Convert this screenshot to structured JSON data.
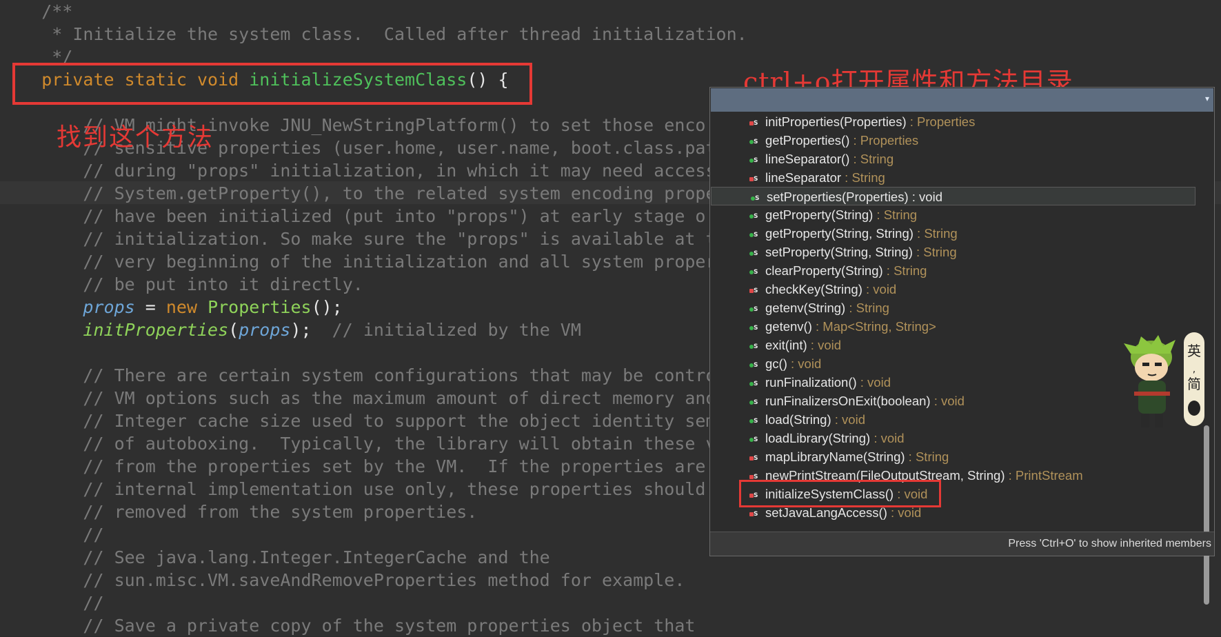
{
  "code": {
    "line1": "    /**",
    "line2": "     * Initialize the system class.  Called after thread initialization.",
    "line3": "     */",
    "decl_kw": "private static void ",
    "decl_fn": "initializeSystemClass",
    "decl_end": "() {",
    "c1": "        // VM might invoke JNU_NewStringPlatform() to set those enco",
    "c2": "        // sensitive properties (user.home, user.name, boot.class.pat",
    "c3": "        // during \"props\" initialization, in which it may need access",
    "c4": "        // System.getProperty(), to the related system encoding prope",
    "c5": "        // have been initialized (put into \"props\") at early stage o",
    "c6": "        // initialization. So make sure the \"props\" is available at t",
    "c7": "        // very beginning of the initialization and all system proper",
    "c8": "        // be put into it directly.",
    "s1_var": "props",
    "s1_eq": " = ",
    "s1_new": "new ",
    "s1_cls": "Properties",
    "s1_end": "();",
    "s2_fn": "initProperties",
    "s2_open": "(",
    "s2_arg": "props",
    "s2_close": ");",
    "s2_comment": "  // initialized by the VM",
    "c9": "        // There are certain system configurations that may be contro",
    "c10": "        // VM options such as the maximum amount of direct memory and",
    "c11": "        // Integer cache size used to support the object identity sem",
    "c12": "        // of autoboxing.  Typically, the library will obtain these v",
    "c13": "        // from the properties set by the VM.  If the properties are",
    "c14": "        // internal implementation use only, these properties should",
    "c15": "        // removed from the system properties.",
    "c16": "        //",
    "c17": "        // See java.lang.Integer.IntegerCache and the",
    "c18": "        // sun.misc.VM.saveAndRemoveProperties method for example.",
    "c19": "        //",
    "c20": "        // Save a private copy of the system properties object that"
  },
  "annotations": {
    "find_method": "找到这个方法",
    "ctrl_o": "ctrl+o打开属性和方法目录"
  },
  "outline": {
    "items": [
      {
        "name": "initProperties(Properties)",
        "type": " : Properties"
      },
      {
        "name": "getProperties()",
        "type": " : Properties"
      },
      {
        "name": "lineSeparator()",
        "type": " : String"
      },
      {
        "name": "lineSeparator",
        "type": " : String"
      },
      {
        "name": "setProperties(Properties)",
        "type": " : void"
      },
      {
        "name": "getProperty(String)",
        "type": " : String"
      },
      {
        "name": "getProperty(String, String)",
        "type": " : String"
      },
      {
        "name": "setProperty(String, String)",
        "type": " : String"
      },
      {
        "name": "clearProperty(String)",
        "type": " : String"
      },
      {
        "name": "checkKey(String)",
        "type": " : void"
      },
      {
        "name": "getenv(String)",
        "type": " : String"
      },
      {
        "name": "getenv()",
        "type": " : Map<String, String>"
      },
      {
        "name": "exit(int)",
        "type": " : void"
      },
      {
        "name": "gc()",
        "type": " : void"
      },
      {
        "name": "runFinalization()",
        "type": " : void"
      },
      {
        "name": "runFinalizersOnExit(boolean)",
        "type": " : void"
      },
      {
        "name": "load(String)",
        "type": " : void"
      },
      {
        "name": "loadLibrary(String)",
        "type": " : void"
      },
      {
        "name": "mapLibraryName(String)",
        "type": " : String"
      },
      {
        "name": "newPrintStream(FileOutputStream, String)",
        "type": " : PrintStream"
      },
      {
        "name": "initializeSystemClass()",
        "type": " : void"
      },
      {
        "name": "setJavaLangAccess()",
        "type": " : void"
      }
    ],
    "status": "Press 'Ctrl+O' to show inherited members"
  },
  "mascot": {
    "sign_top": "英",
    "sign_bottom": "简"
  }
}
